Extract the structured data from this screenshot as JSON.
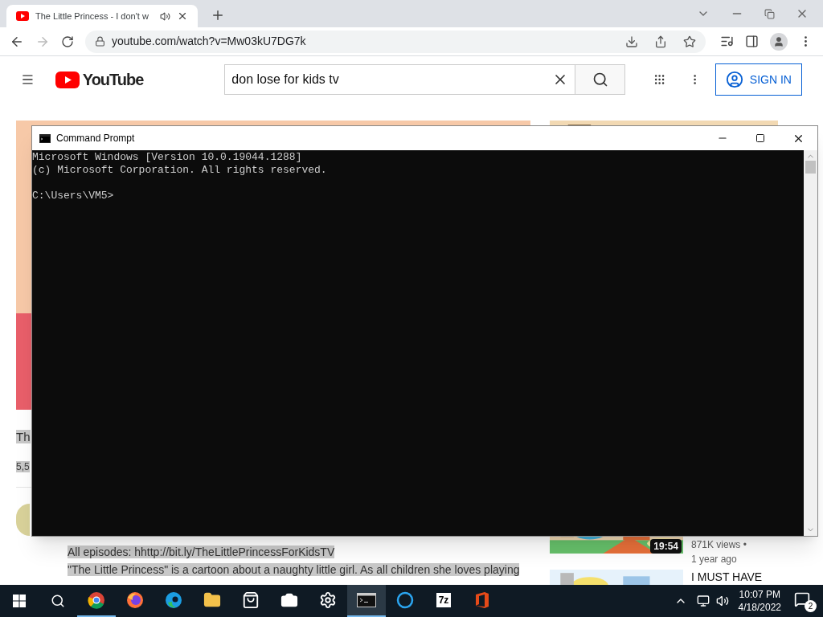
{
  "browser": {
    "tab": {
      "title": "The Little Princess - I don't w"
    },
    "address": "youtube.com/watch?v=Mw03kU7DG7k"
  },
  "youtube": {
    "logo": "YouTube",
    "search": {
      "value": "don lose for kids tv"
    },
    "sign_in": "SIGN IN"
  },
  "video": {
    "title": "Th",
    "views": "5,5",
    "description": [
      "All episodes: hhttp://bit.ly/TheLittlePrincessForKidsTV",
      "\"The Little Princess\" is a cartoon about a naughty little girl. As all children she loves playing"
    ]
  },
  "related": [
    {
      "duration": "19:54",
      "meta": [
        "871K views •",
        "1 year ago"
      ]
    },
    {
      "title": "I MUST HAVE"
    }
  ],
  "cmd": {
    "title": "Command Prompt",
    "output": [
      "Microsoft Windows [Version 10.0.19044.1288]",
      "(c) Microsoft Corporation. All rights reserved."
    ],
    "prompt": "C:\\Users\\VM5>"
  },
  "taskbar": {
    "apps": [
      {
        "kind": "chrome",
        "running": true,
        "selected": false
      },
      {
        "kind": "firefox",
        "running": false,
        "selected": false
      },
      {
        "kind": "edge",
        "running": false,
        "selected": false
      },
      {
        "kind": "folder",
        "running": false,
        "selected": false
      },
      {
        "kind": "store",
        "running": false,
        "selected": false
      },
      {
        "kind": "camera",
        "running": false,
        "selected": false
      },
      {
        "kind": "settings",
        "running": false,
        "selected": false
      },
      {
        "kind": "cmd",
        "running": true,
        "selected": true
      },
      {
        "kind": "cortana",
        "running": false,
        "selected": false
      },
      {
        "kind": "archiver",
        "label": "7z",
        "running": false,
        "selected": false
      },
      {
        "kind": "office",
        "running": false,
        "selected": false
      }
    ],
    "clock": {
      "time": "10:07 PM",
      "date": "4/18/2022"
    },
    "notifications": "2"
  }
}
